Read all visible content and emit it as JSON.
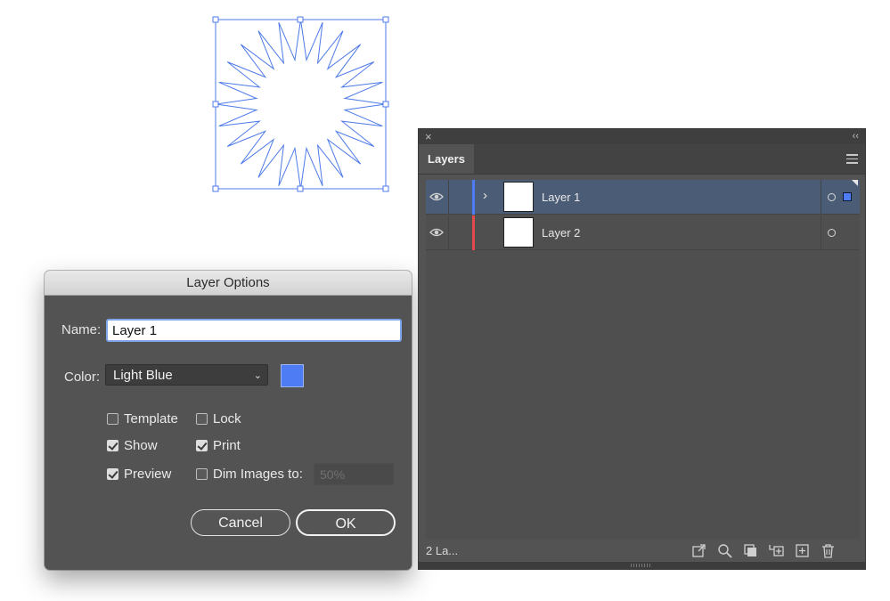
{
  "dialog": {
    "title": "Layer Options",
    "name_label": "Name:",
    "name_value": "Layer 1",
    "color_label": "Color:",
    "color_value": "Light Blue",
    "color_swatch": "#4e7cf5",
    "checkboxes": {
      "template": {
        "label": "Template",
        "checked": false
      },
      "lock": {
        "label": "Lock",
        "checked": false
      },
      "show": {
        "label": "Show",
        "checked": true
      },
      "print": {
        "label": "Print",
        "checked": true
      },
      "preview": {
        "label": "Preview",
        "checked": true
      },
      "dim_images": {
        "label": "Dim Images to:",
        "checked": false
      }
    },
    "dim_value": "50%",
    "cancel_label": "Cancel",
    "ok_label": "OK"
  },
  "layers_panel": {
    "tab_label": "Layers",
    "layers": [
      {
        "name": "Layer 1",
        "color": "#4e7cf5",
        "selected": true
      },
      {
        "name": "Layer 2",
        "color": "#e5484d",
        "selected": false
      }
    ],
    "footer_count": "2 La...",
    "footer_icons": [
      "export-icon",
      "search-icon",
      "clipping-mask-icon",
      "new-sublayer-icon",
      "new-layer-icon",
      "trash-icon"
    ]
  },
  "icons": {
    "close": "×",
    "collapse": "‹‹",
    "expander": "›",
    "chevron": "⌄"
  }
}
